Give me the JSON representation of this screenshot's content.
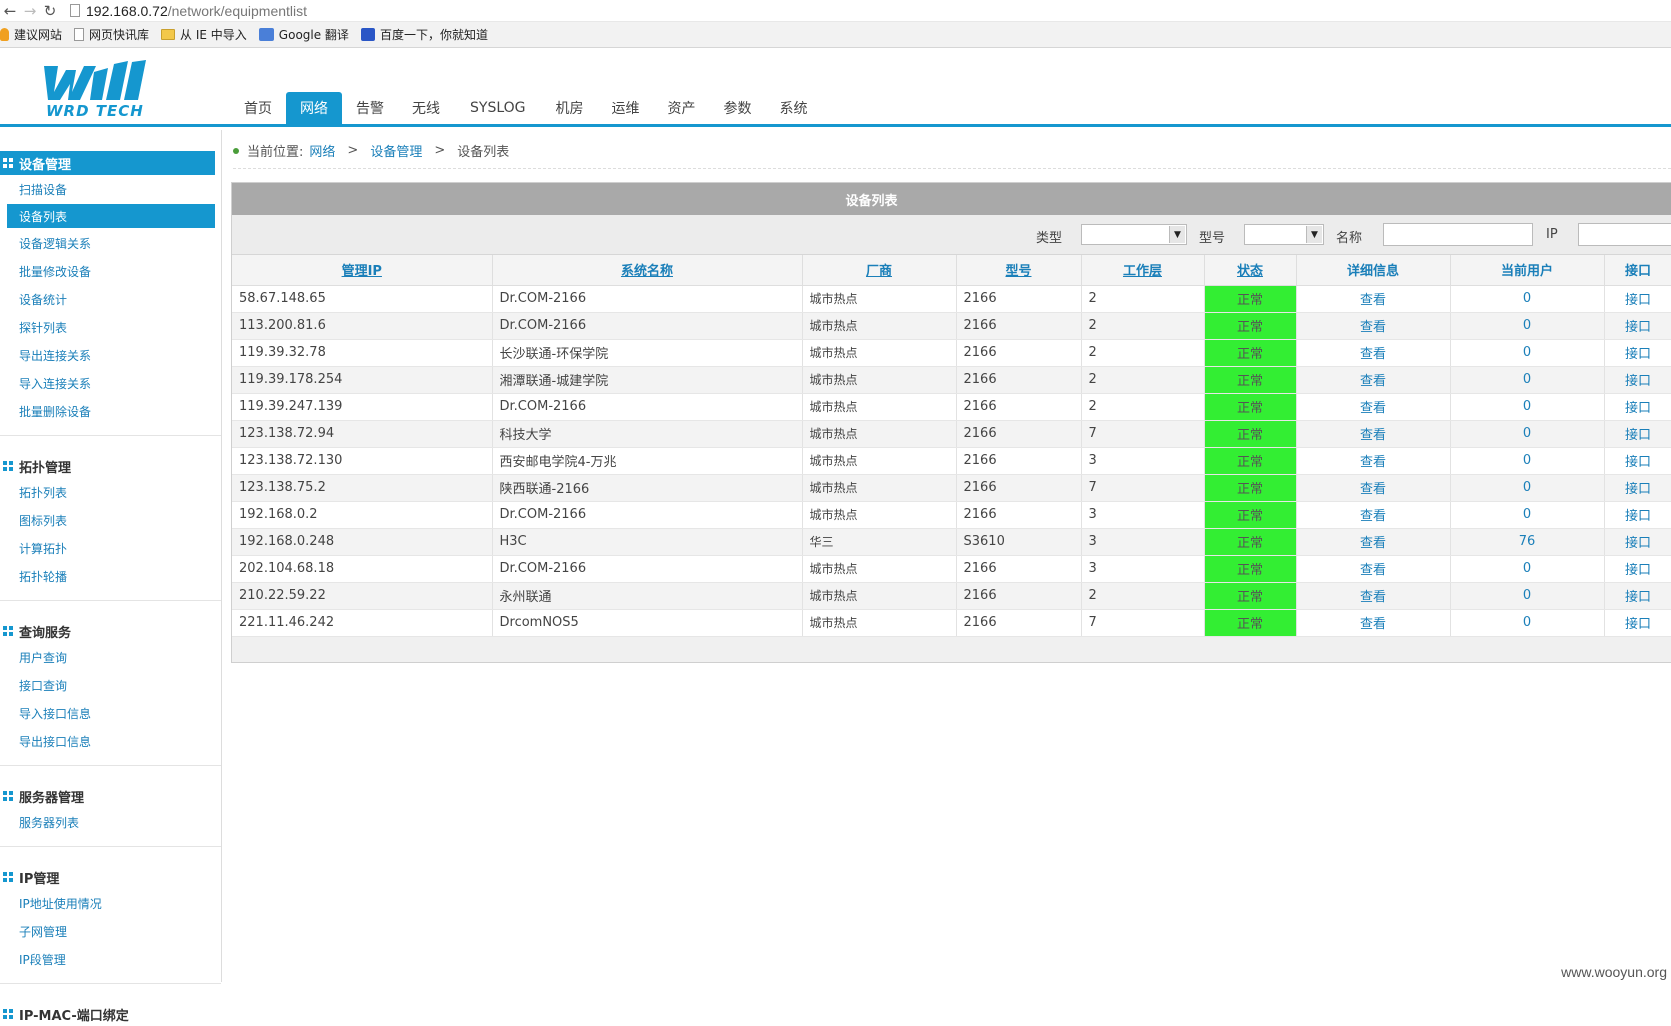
{
  "browser": {
    "url_host": "192.168.0.72",
    "url_path": "/network/equipmentlist",
    "bookmarks": [
      "建议网站",
      "网页快讯库",
      "从 IE 中导入",
      "Google 翻译",
      "百度一下，你就知道"
    ]
  },
  "header": {
    "logo_text": "WRD TECH",
    "tabs": [
      "首页",
      "网络",
      "告警",
      "无线",
      "SYSLOG",
      "机房",
      "运维",
      "资产",
      "参数",
      "系统"
    ],
    "active_tab": "网络"
  },
  "sidebar": {
    "sections": [
      {
        "title": "设备管理",
        "items": [
          "扫描设备",
          "设备列表",
          "设备逻辑关系",
          "批量修改设备",
          "设备统计",
          "探针列表",
          "导出连接关系",
          "导入连接关系",
          "批量删除设备"
        ]
      },
      {
        "title": "拓扑管理",
        "items": [
          "拓扑列表",
          "图标列表",
          "计算拓扑",
          "拓扑轮播"
        ]
      },
      {
        "title": "查询服务",
        "items": [
          "用户查询",
          "接口查询",
          "导入接口信息",
          "导出接口信息"
        ]
      },
      {
        "title": "服务器管理",
        "items": [
          "服务器列表"
        ]
      },
      {
        "title": "IP管理",
        "items": [
          "IP地址使用情况",
          "子网管理",
          "IP段管理"
        ]
      },
      {
        "title": "IP-MAC-端口绑定",
        "items": []
      }
    ]
  },
  "breadcrumb": {
    "prefix": "当前位置:",
    "level1": "网络",
    "sep": ">",
    "level2": "设备管理",
    "level3": "设备列表"
  },
  "panel": {
    "title": "设备列表",
    "filters": {
      "type_label": "类型",
      "model_label": "型号",
      "name_label": "名称",
      "ip_label": "IP"
    },
    "columns": [
      "管理IP",
      "系统名称",
      "厂商",
      "型号",
      "工作层",
      "状态",
      "详细信息",
      "当前用户",
      "接口"
    ],
    "rows": [
      [
        "58.67.148.65",
        "Dr.COM-2166",
        "城市热点",
        "2166",
        "2",
        "正常",
        "查看",
        "0",
        "接口"
      ],
      [
        "113.200.81.6",
        "Dr.COM-2166",
        "城市热点",
        "2166",
        "2",
        "正常",
        "查看",
        "0",
        "接口"
      ],
      [
        "119.39.32.78",
        "长沙联通-环保学院",
        "城市热点",
        "2166",
        "2",
        "正常",
        "查看",
        "0",
        "接口"
      ],
      [
        "119.39.178.254",
        "湘潭联通-城建学院",
        "城市热点",
        "2166",
        "2",
        "正常",
        "查看",
        "0",
        "接口"
      ],
      [
        "119.39.247.139",
        "Dr.COM-2166",
        "城市热点",
        "2166",
        "2",
        "正常",
        "查看",
        "0",
        "接口"
      ],
      [
        "123.138.72.94",
        "科技大学",
        "城市热点",
        "2166",
        "7",
        "正常",
        "查看",
        "0",
        "接口"
      ],
      [
        "123.138.72.130",
        "西安邮电学院4-万兆",
        "城市热点",
        "2166",
        "3",
        "正常",
        "查看",
        "0",
        "接口"
      ],
      [
        "123.138.75.2",
        "陕西联通-2166",
        "城市热点",
        "2166",
        "7",
        "正常",
        "查看",
        "0",
        "接口"
      ],
      [
        "192.168.0.2",
        "Dr.COM-2166",
        "城市热点",
        "2166",
        "3",
        "正常",
        "查看",
        "0",
        "接口"
      ],
      [
        "192.168.0.248",
        "H3C",
        "华三",
        "S3610",
        "3",
        "正常",
        "查看",
        "76",
        "接口"
      ],
      [
        "202.104.68.18",
        "Dr.COM-2166",
        "城市热点",
        "2166",
        "3",
        "正常",
        "查看",
        "0",
        "接口"
      ],
      [
        "210.22.59.22",
        "永州联通",
        "城市热点",
        "2166",
        "2",
        "正常",
        "查看",
        "0",
        "接口"
      ],
      [
        "221.11.46.242",
        "DrcomNOS5",
        "城市热点",
        "2166",
        "7",
        "正常",
        "查看",
        "0",
        "接口"
      ]
    ]
  },
  "watermark": "www.wooyun.org",
  "colors": {
    "accent": "#1597cf",
    "status_ok": "#33ee33",
    "link": "#1a7fb9"
  }
}
